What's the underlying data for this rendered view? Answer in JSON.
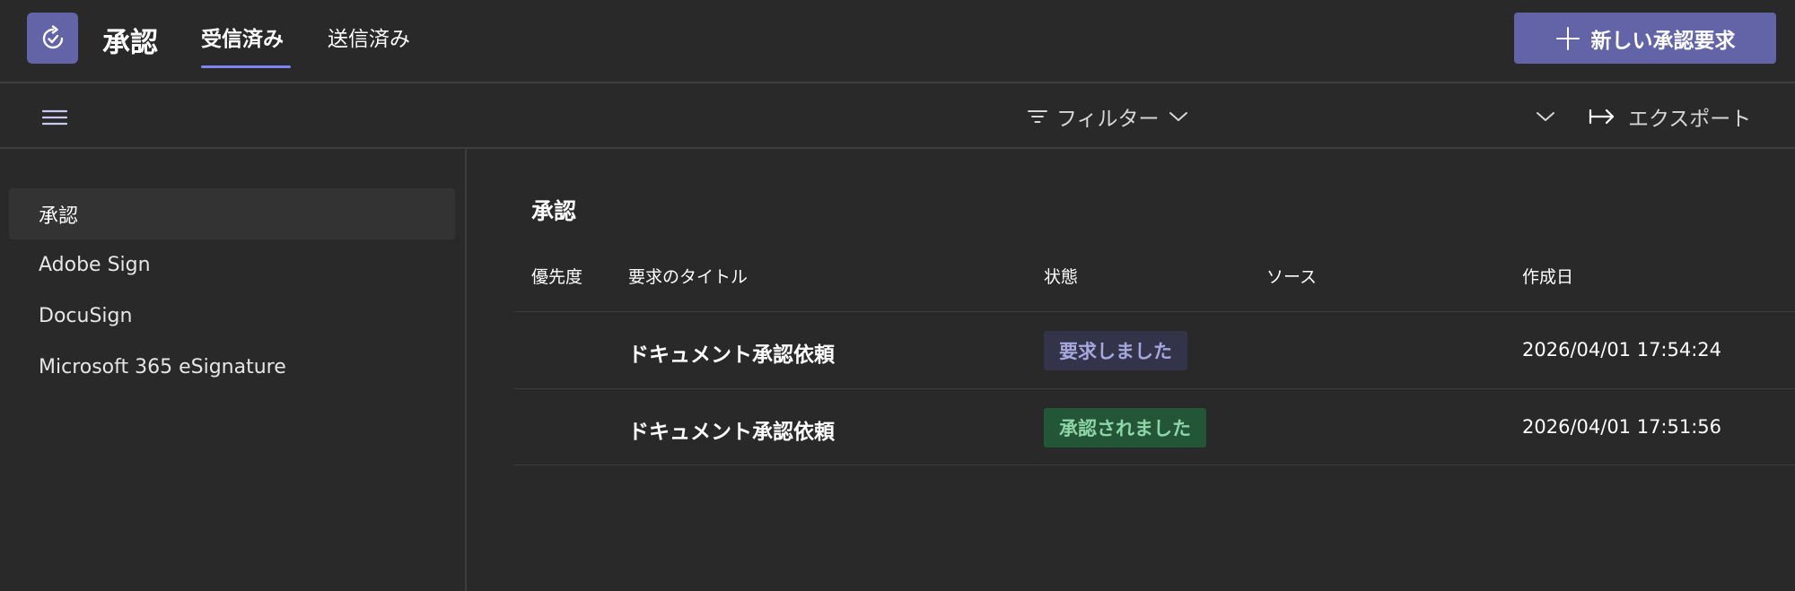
{
  "header": {
    "app_title": "承認",
    "tabs": [
      {
        "label": "受信済み",
        "active": true
      },
      {
        "label": "送信済み",
        "active": false
      }
    ],
    "new_request_label": "新しい承認要求",
    "app_icon": "refresh-check-icon"
  },
  "toolbar": {
    "menu_icon": "hamburger-icon",
    "filter_label": "フィルター",
    "export_label": "エクスポート"
  },
  "sidebar": {
    "items": [
      {
        "label": "承認",
        "active": true
      },
      {
        "label": "Adobe Sign",
        "active": false
      },
      {
        "label": "DocuSign",
        "active": false
      },
      {
        "label": "Microsoft 365 eSignature",
        "active": false
      }
    ]
  },
  "main": {
    "section_title": "承認",
    "columns": {
      "priority": "優先度",
      "title": "要求のタイトル",
      "status": "状態",
      "source": "ソース",
      "created": "作成日"
    },
    "rows": [
      {
        "title": "ドキュメント承認依頼",
        "status": "要求しました",
        "source": "",
        "created": "2026/04/01 17:54:24"
      },
      {
        "title": "ドキュメント承認依頼",
        "status": "承認されました",
        "source": "",
        "created": "2026/04/01 17:51:56"
      }
    ]
  },
  "colors": {
    "accent": "#6264a7",
    "background": "#292929",
    "status_requested_bg": "#33344a",
    "status_requested_fg": "#a6a7dc",
    "status_approved_bg": "#235637",
    "status_approved_fg": "#8fd4a8"
  }
}
